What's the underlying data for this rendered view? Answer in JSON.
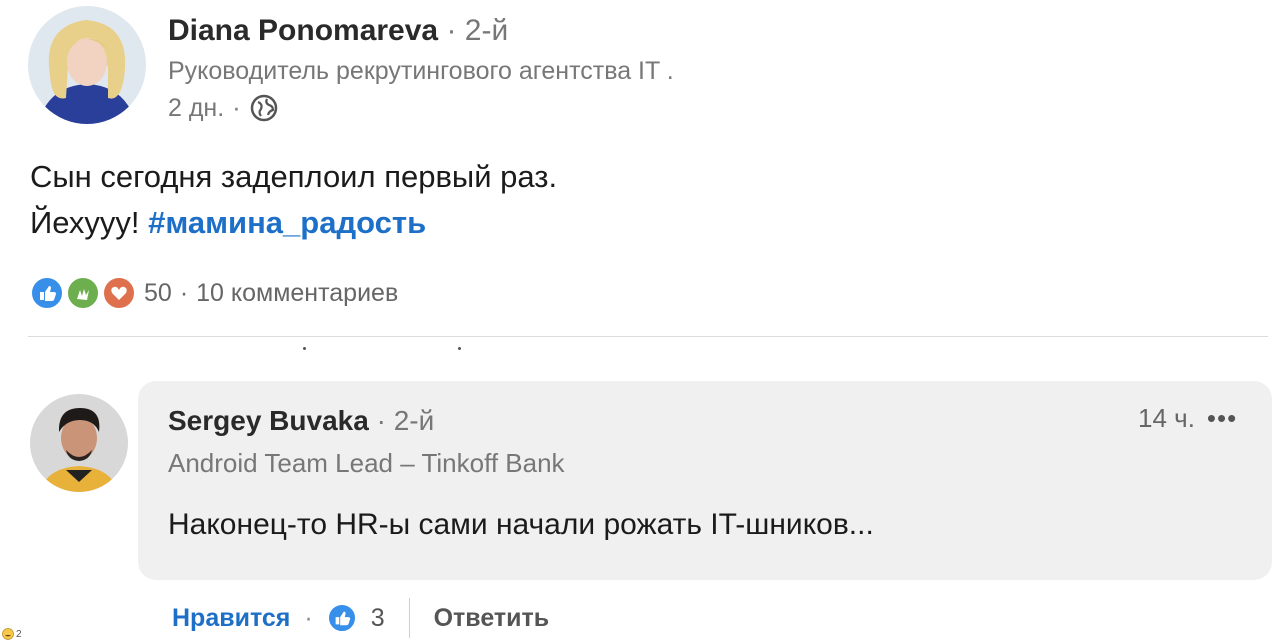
{
  "post": {
    "author_name": "Diana Ponomareva",
    "author_degree": "2-й",
    "author_headline": "Руководитель рекрутингового агентства IT .",
    "time": "2 дн.",
    "text_line1": "Сын сегодня задеплоил первый раз.",
    "text_line2": "Йехууу!",
    "hashtag": "#мамина_радость",
    "reaction_count": "50",
    "comments_count": "10 комментариев"
  },
  "comment": {
    "author_name": "Sergey Buvaka",
    "author_degree": "2-й",
    "author_headline": "Android Team Lead – Tinkoff Bank",
    "time": "14 ч.",
    "more": "•••",
    "text": "Наконец-то HR-ы сами начали рожать IT-шников...",
    "like_label": "Нравится",
    "like_count": "3",
    "reply_label": "Ответить"
  },
  "separator": "·",
  "bottom_badge_count": "2",
  "icons": {
    "globe": "globe-icon",
    "like": "like-reaction-icon",
    "celebrate": "celebrate-reaction-icon",
    "love": "love-reaction-icon"
  },
  "colors": {
    "hashtag": "#1d6fc7",
    "like_link": "#1d6fc7",
    "comment_bg": "#f0f0f0"
  }
}
